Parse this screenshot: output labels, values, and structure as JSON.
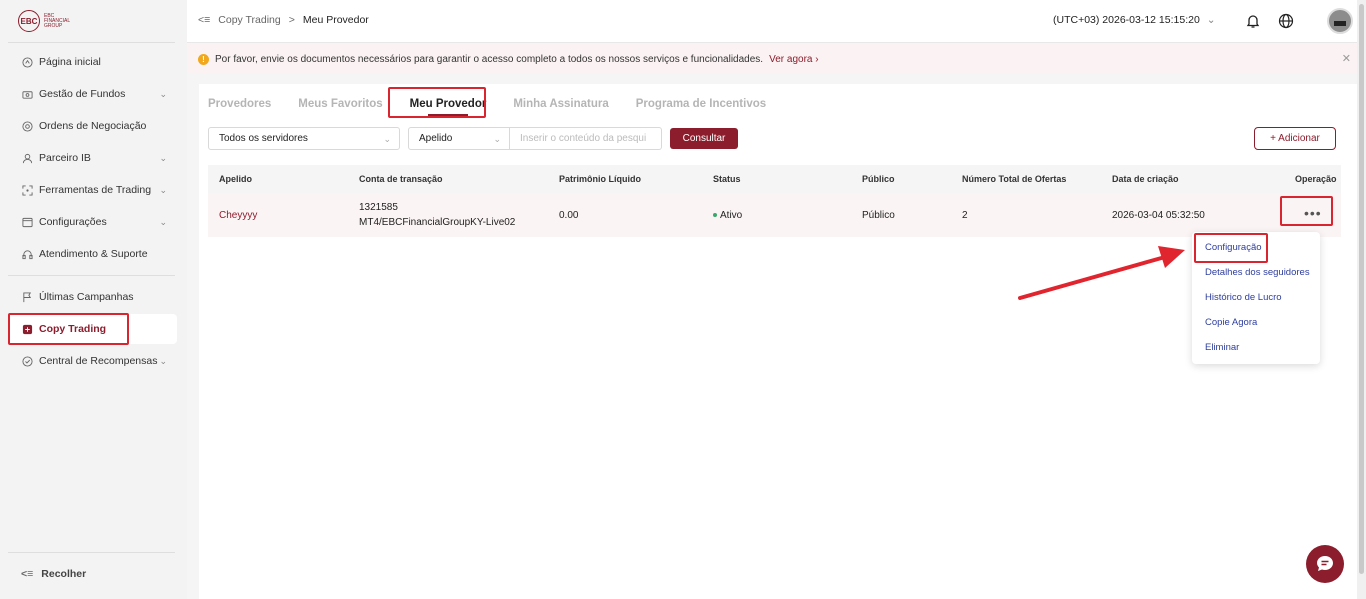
{
  "brand": {
    "logo_mark": "EBC",
    "logo_text": "EBC FINANCIAL GROUP",
    "accent": "#8b1d2c"
  },
  "sidebar": {
    "items": [
      {
        "label": "Página inicial",
        "icon": "home-icon",
        "chevron": false
      },
      {
        "label": "Gestão de Fundos",
        "icon": "wallet-icon",
        "chevron": true
      },
      {
        "label": "Ordens de Negociação",
        "icon": "orders-icon",
        "chevron": false
      },
      {
        "label": "Parceiro IB",
        "icon": "partner-icon",
        "chevron": true
      },
      {
        "label": "Ferramentas de Trading",
        "icon": "tools-icon",
        "chevron": true
      },
      {
        "label": "Configurações",
        "icon": "settings-icon",
        "chevron": true
      },
      {
        "label": "Atendimento & Suporte",
        "icon": "headset-icon",
        "chevron": false
      },
      {
        "label": "Últimas Campanhas",
        "icon": "flag-icon",
        "chevron": false
      },
      {
        "label": "Copy Trading",
        "icon": "copy-trading-icon",
        "chevron": false,
        "active": true
      },
      {
        "label": "Central de Recompensas",
        "icon": "reward-icon",
        "chevron": true
      }
    ],
    "collapse_label": "Recolher"
  },
  "header": {
    "breadcrumb": [
      "Copy Trading",
      "Meu Provedor"
    ],
    "datetime": "(UTC+03)  2026-03-12 15:15:20"
  },
  "notice": {
    "text": "Por favor, envie os documentos necessários para garantir o acesso completo a todos os nossos serviços e funcionalidades.",
    "link": "Ver agora"
  },
  "tabs": [
    "Provedores",
    "Meus Favoritos",
    "Meu Provedor",
    "Minha Assinatura",
    "Programa de Incentivos"
  ],
  "active_tab": "Meu Provedor",
  "filters": {
    "server_value": "Todos os servidores",
    "field_value": "Apelido",
    "search_placeholder": "Inserir o conteúdo da pesqui",
    "search_button": "Consultar",
    "add_button": "+ Adicionar"
  },
  "table": {
    "columns": [
      "Apelido",
      "Conta de transação",
      "Patrimônio Líquido",
      "Status",
      "Público",
      "Número Total de Ofertas",
      "Data de criação",
      "Operação"
    ],
    "rows": [
      {
        "apelido": "Cheyyyy",
        "conta_line1": "1321585",
        "conta_line2": "MT4/EBCFinancialGroupKY-Live02",
        "patrimonio": "0.00",
        "status": "Ativo",
        "publico": "Público",
        "ofertas": "2",
        "data": "2026-03-04 05:32:50",
        "operacao": "•••"
      }
    ]
  },
  "menu": {
    "items": [
      "Configuração",
      "Detalhes dos seguidores",
      "Histórico de Lucro",
      "Copie Agora",
      "Eliminar"
    ]
  }
}
